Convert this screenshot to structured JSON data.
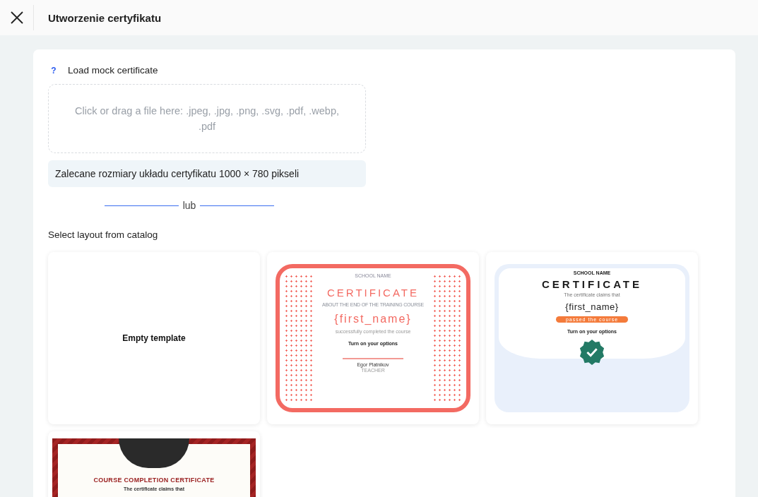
{
  "header": {
    "title": "Utworzenie certyfikatu"
  },
  "upload": {
    "help": "?",
    "label": "Load mock certificate",
    "dropzone": "Click or drag a file here: .jpeg, .jpg, .png, .svg, .pdf, .webp, .pdf",
    "hint": "Zalecane rozmiary układu certyfikatu 1000 × 780 pikseli"
  },
  "divider": "lub",
  "catalog": {
    "label": "Select layout from catalog",
    "templates": [
      {
        "kind": "empty",
        "label": "Empty template"
      },
      {
        "kind": "coral",
        "school": "SCHOOL NAME",
        "title": "CERTIFICATE",
        "subtitle": "ABOUT THE END OF THE TRAINING COURSE",
        "name": "{first_name}",
        "note": "successfully completed the course",
        "options": "Turn on your options",
        "signer": "Egor Platnikov",
        "role": "TEACHER"
      },
      {
        "kind": "blue",
        "school": "SCHOOL NAME",
        "title": "CERTIFICATE",
        "claims": "The certificate claims that",
        "name": "{first_name}",
        "badge": "passed the course",
        "options": "Turn on your options"
      },
      {
        "kind": "red",
        "title": "COURSE COMPLETION CERTIFICATE",
        "claims": "The certificate claims that"
      }
    ]
  }
}
